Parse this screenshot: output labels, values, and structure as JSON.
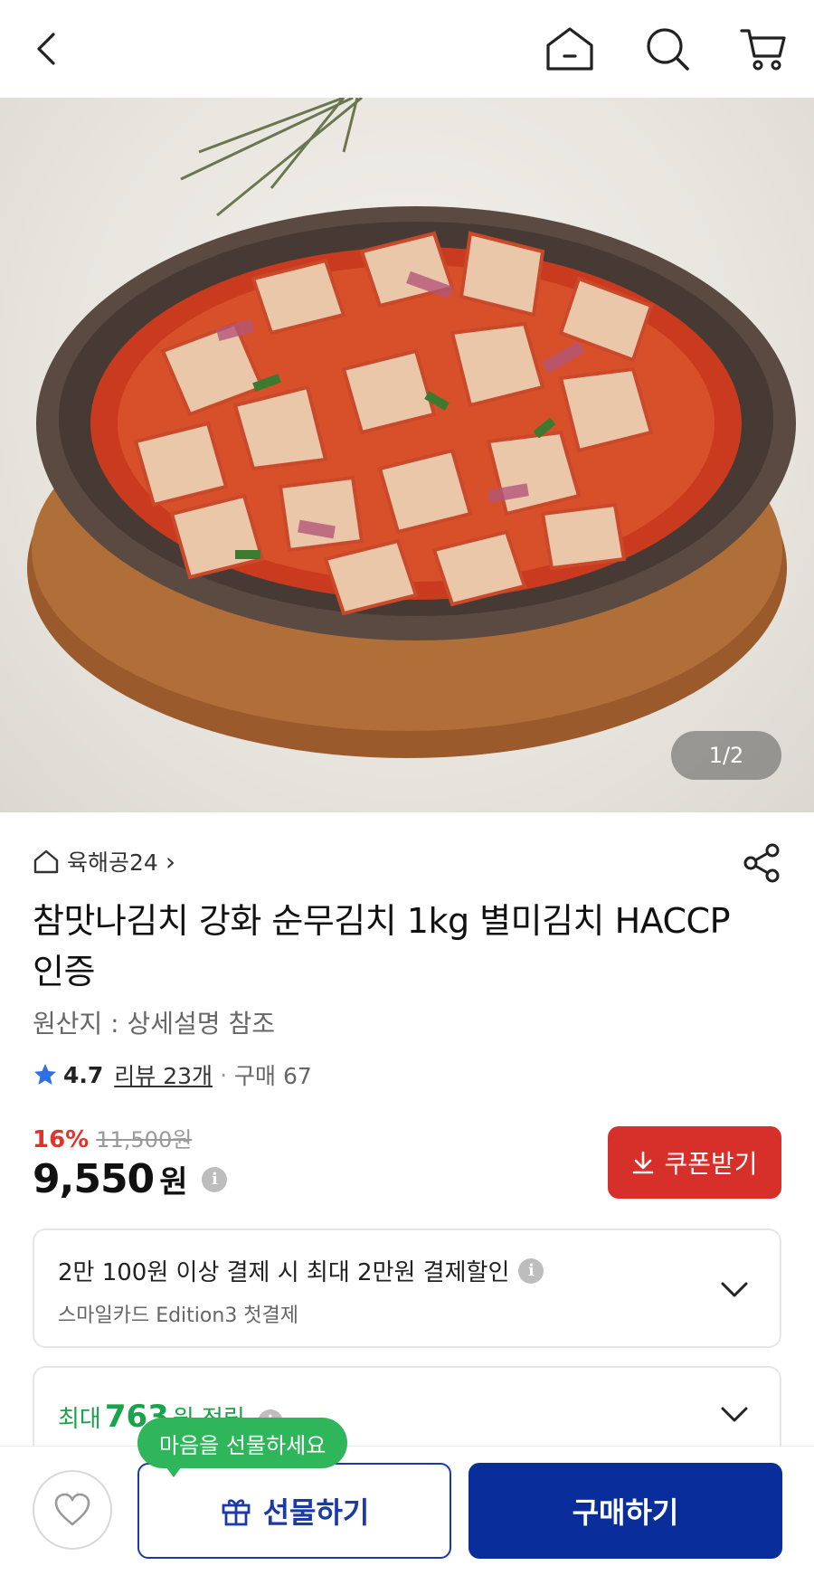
{
  "topbar": {
    "back_icon": "chevron-left-icon",
    "home_icon": "home-icon",
    "search_icon": "search-icon",
    "cart_icon": "cart-icon"
  },
  "hero": {
    "page_indicator": "1/2"
  },
  "product": {
    "seller": "육해공24",
    "seller_arrow": "›",
    "title": "참맛나김치 강화 순무김치 1kg 별미김치 HACCP인증",
    "origin": "원산지 : 상세설명 참조",
    "rating": "4.7",
    "reviews": "리뷰 23개",
    "separator": "·",
    "purchases": "구매 67",
    "discount_rate": "16%",
    "original_price": "11,500원",
    "price": "9,550",
    "price_unit": "원",
    "info_glyph": "i"
  },
  "coupon": {
    "label": "쿠폰받기"
  },
  "payment_card": {
    "line1": "2만 100원 이상 결제 시 최대 2만원 결제할인",
    "line2": "스마일카드 Edition3 첫결제"
  },
  "points_card": {
    "prefix": "최대",
    "amount": "763",
    "suffix": "원 적립"
  },
  "bottombar": {
    "tooltip": "마음을 선물하세요",
    "gift_label": "선물하기",
    "buy_label": "구매하기"
  },
  "colors": {
    "accent_red": "#d7302a",
    "primary_blue": "#0a2d9c",
    "green": "#2fb65a",
    "star_blue": "#2f6fe0"
  }
}
